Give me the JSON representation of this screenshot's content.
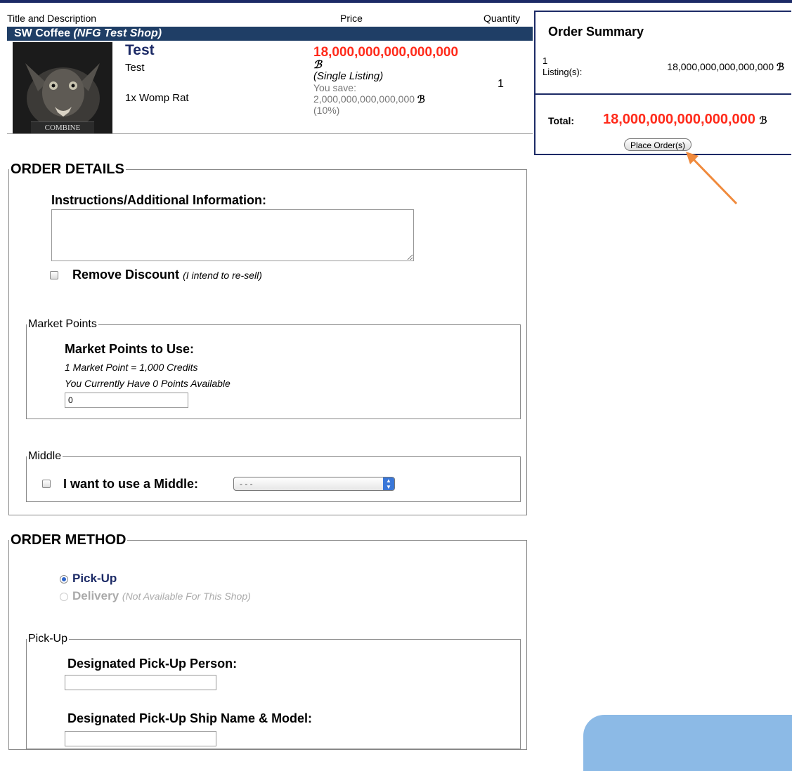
{
  "cart": {
    "col_title": "Title and Description",
    "col_price": "Price",
    "col_quantity": "Quantity",
    "shop_name": "SW Coffee",
    "shop_subtitle": "(NFG Test Shop)",
    "item": {
      "thumbnail_caption": "COMBINE",
      "title": "Test",
      "description": "Test",
      "contents": "1x Womp Rat",
      "price": "18,000,000,000,000,000",
      "listing_type": "(Single Listing)",
      "save_label": "You save:",
      "save_amount": "2,000,000,000,000,000",
      "save_percent": "(10%)",
      "quantity": "1"
    }
  },
  "currency_symbol": "ℬ",
  "summary": {
    "title": "Order Summary",
    "count": "1",
    "count_label": "Listing(s):",
    "subtotal": "18,000,000,000,000,000",
    "total_label": "Total:",
    "total": "18,000,000,000,000,000",
    "place_order_label": "Place Order(s)"
  },
  "order_details": {
    "legend": "ORDER DETAILS",
    "instructions_label": "Instructions/Additional Information:",
    "instructions_value": "",
    "remove_discount_label": "Remove Discount",
    "remove_discount_note": "(I intend to re-sell)",
    "market_points": {
      "legend": "Market Points",
      "label": "Market Points to Use:",
      "rate_note": "1 Market Point = 1,000 Credits",
      "available_note": "You Currently Have 0 Points Available",
      "value": "0"
    },
    "middle": {
      "legend": "Middle",
      "label": "I want to use a Middle:",
      "selected": "- - -"
    }
  },
  "order_method": {
    "legend": "ORDER METHOD",
    "options": [
      {
        "label": "Pick-Up",
        "note": "",
        "selected": true,
        "enabled": true
      },
      {
        "label": "Delivery",
        "note": "(Not Available For This Shop)",
        "selected": false,
        "enabled": false
      }
    ],
    "pickup": {
      "legend": "Pick-Up",
      "person_label": "Designated Pick-Up Person:",
      "person_value": "",
      "ship_label": "Designated Pick-Up Ship Name & Model:",
      "ship_value": ""
    }
  },
  "colors": {
    "navy": "#1c2a66",
    "shop_bar": "#1f3e66",
    "price_red": "#ff2a1a",
    "annotation_arrow": "#f08a3c"
  }
}
